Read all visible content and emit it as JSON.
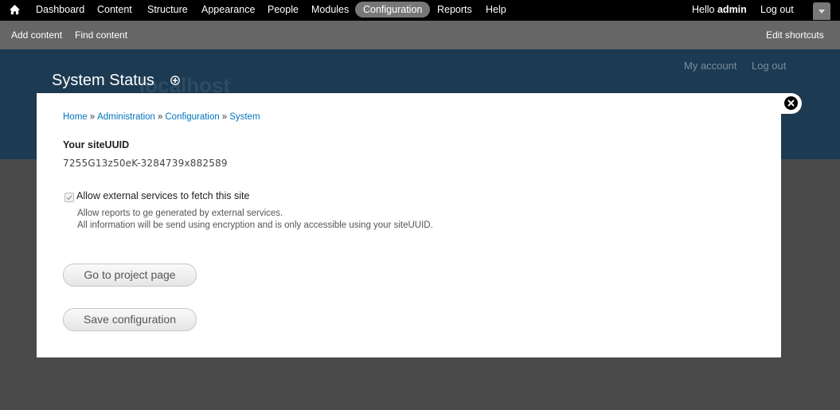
{
  "toolbar": {
    "menu": [
      "Dashboard",
      "Content",
      "Structure",
      "Appearance",
      "People",
      "Modules",
      "Configuration",
      "Reports",
      "Help"
    ],
    "active_item": "Configuration",
    "hello_prefix": "Hello",
    "username": "admin",
    "logout": "Log out"
  },
  "shortcuts": {
    "add_content": "Add content",
    "find_content": "Find content",
    "edit_shortcuts": "Edit shortcuts"
  },
  "header": {
    "site_name": "localhost",
    "secondary_links": [
      "My account",
      "Log out"
    ],
    "page_title": "System Status"
  },
  "overlay": {
    "breadcrumb": [
      "Home",
      "Administration",
      "Configuration",
      "System"
    ],
    "breadcrumb_separator": "»",
    "uuid_label": "Your siteUUID",
    "uuid_value": "7255G13z50eK-3284739x882589",
    "checkbox_label": "Allow external services to fetch this site",
    "checkbox_checked": true,
    "description_lines": [
      "Allow reports to ge generated by external services.",
      "All information will be send using encryption and is only accessible using your siteUUID."
    ],
    "project_button": "Go to project page",
    "save_button": "Save configuration"
  },
  "icons": {
    "home": "home-icon",
    "toolbar_toggle": "chevron-down-icon",
    "add_shortcut": "plus-circle-icon",
    "close": "close-icon",
    "checkmark": "check-icon"
  },
  "colors": {
    "toolbar_bg": "#000000",
    "shortcuts_bg": "#666666",
    "header_bg": "#1c3a52",
    "link": "#0074bd",
    "active_tab": "#777777"
  }
}
